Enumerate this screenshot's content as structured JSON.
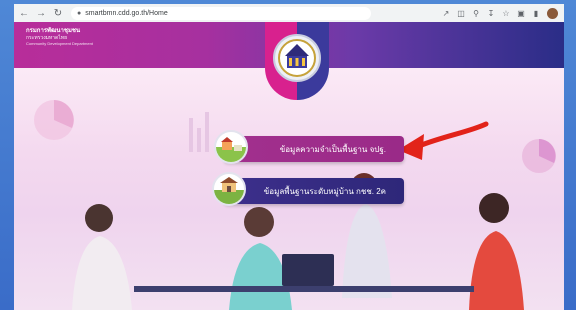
{
  "browser": {
    "url": "smartbmn.cdd.go.th/Home",
    "icons": [
      "back-icon",
      "forward-icon",
      "reload-icon",
      "lock-icon",
      "share-icon",
      "translate-icon",
      "zoom-icon",
      "save-icon",
      "star-icon",
      "extensions-icon",
      "sidebar-icon",
      "avatar"
    ]
  },
  "header": {
    "dept_line1": "กรมการพัฒนาชุมชน",
    "dept_line2": "กระทรวงมหาดไทย",
    "dept_line3": "Community Development Department",
    "emblem_text": "จปฐ."
  },
  "menu": [
    {
      "label": "ข้อมูลความจำเป็นพื้นฐาน จปฐ."
    },
    {
      "label": "ข้อมูลพื้นฐานระดับหมู่บ้าน กชช. 2ค"
    }
  ],
  "colors": {
    "header_pink": "#b82d9a",
    "header_navy": "#2a2d87",
    "button1": "#a2308e",
    "button2": "#3d2f8c",
    "arrow": "#e2231a"
  }
}
